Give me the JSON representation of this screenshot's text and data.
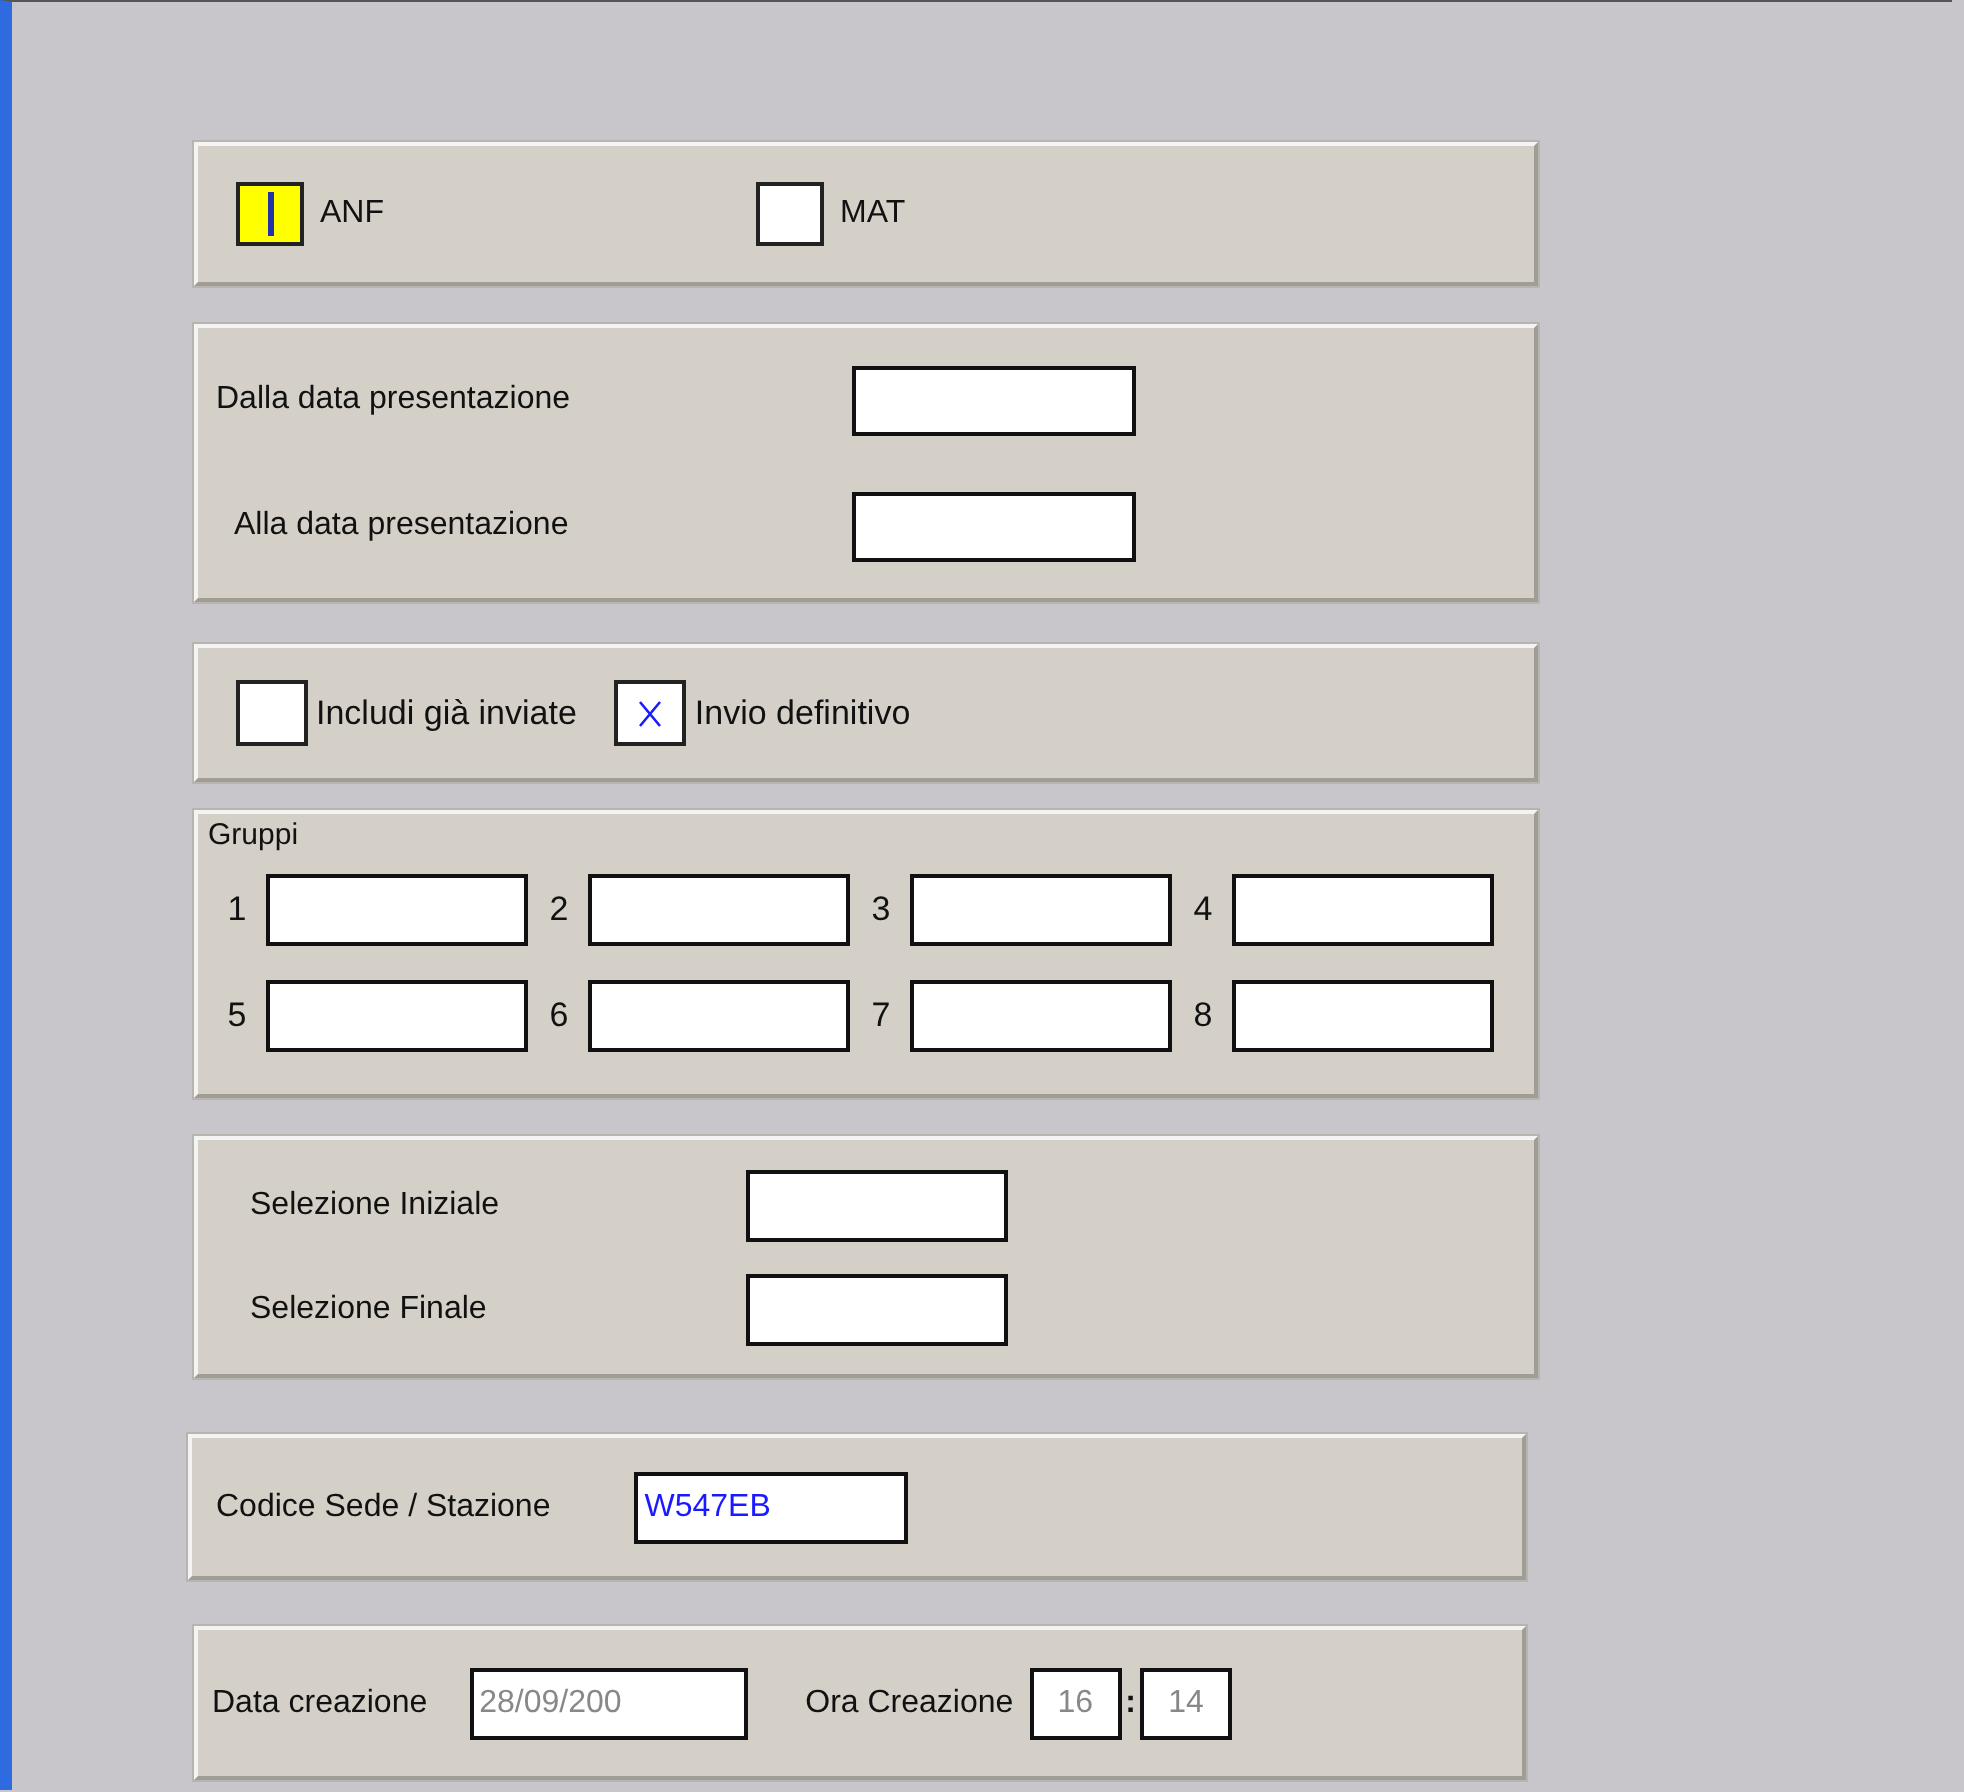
{
  "type_checks": [
    {
      "label": "ANF",
      "checked": true,
      "focused": true
    },
    {
      "label": "MAT",
      "checked": false,
      "focused": false
    }
  ],
  "presentation_dates": [
    {
      "label": "Dalla data presentazione"
    },
    {
      "label": "Alla data presentazione"
    }
  ],
  "send_options": [
    {
      "label": "Includi già inviate",
      "checked": false
    },
    {
      "label": "Invio definitivo",
      "checked": true
    }
  ],
  "groups": {
    "title": "Gruppi",
    "fields": [
      {
        "label": "1"
      },
      {
        "label": "2"
      },
      {
        "label": "3"
      },
      {
        "label": "4"
      },
      {
        "label": "5"
      },
      {
        "label": "6"
      },
      {
        "label": "7"
      },
      {
        "label": "8"
      }
    ]
  },
  "selection": [
    {
      "label": "Selezione Iniziale"
    },
    {
      "label": "Selezione Finale"
    }
  ],
  "station": {
    "label": "Codice Sede / Stazione",
    "value": "W547EB"
  },
  "creation": {
    "date_label": "Data creazione",
    "date_value": "28/09/200",
    "time_label": "Ora Creazione",
    "hour": "16",
    "separator": ":",
    "minute": "14",
    "disabled": true
  }
}
